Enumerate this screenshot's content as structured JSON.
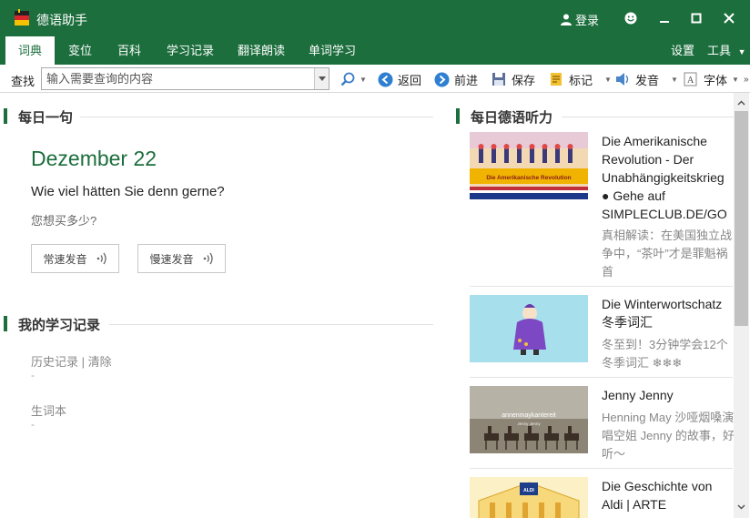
{
  "window": {
    "title": "德语助手",
    "login_label": "登录"
  },
  "tabs": [
    {
      "label": "词典",
      "active": true
    },
    {
      "label": "变位"
    },
    {
      "label": "百科"
    },
    {
      "label": "学习记录"
    },
    {
      "label": "翻译朗读"
    },
    {
      "label": "单词学习"
    }
  ],
  "tabs_right": {
    "settings": "设置",
    "tools": "工具"
  },
  "toolbar": {
    "search_label": "查找",
    "search_placeholder": "输入需要查询的内容",
    "back": "返回",
    "forward": "前进",
    "save": "保存",
    "mark": "标记",
    "pronounce": "发音",
    "font": "字体"
  },
  "daily": {
    "title": "每日一句",
    "date": "Dezember 22",
    "sentence": "Wie viel hätten Sie denn gerne?",
    "translation": "您想买多少?",
    "normal_speed": "常速发音",
    "slow_speed": "慢速发音"
  },
  "records": {
    "title": "我的学习记录",
    "history": "历史记录",
    "separator": "|",
    "clear": "清除",
    "history_value": "-",
    "vocab": "生词本",
    "vocab_value": "-"
  },
  "listening": {
    "title": "每日德语听力",
    "items": [
      {
        "title": "Die Amerikanische Revolution - Der Unabhängigkeitskrieg ● Gehe auf SIMPLECLUB.DE/GO",
        "desc": "真相解读：在美国独立战争中，“茶叶”才是罪魁祸首",
        "thumb_text": "Die Amerikanische Revolution"
      },
      {
        "title": "Die Winterwortschatz 冬季词汇",
        "desc": "冬至到！3分钟学会12个冬季词汇 ❄❄❄"
      },
      {
        "title": "Jenny Jenny",
        "desc": "Henning May 沙哑烟嗓演唱空姐 Jenny 的故事，好听～",
        "thumb_text": "annenmaykantereit",
        "thumb_subtext": "Jenny Jenny"
      },
      {
        "title": "Die Geschichte von Aldi | ARTE",
        "desc": "",
        "thumb_text": "ALDI"
      }
    ]
  },
  "colors": {
    "brand": "#1c6e3d",
    "background": "#ffffff"
  }
}
